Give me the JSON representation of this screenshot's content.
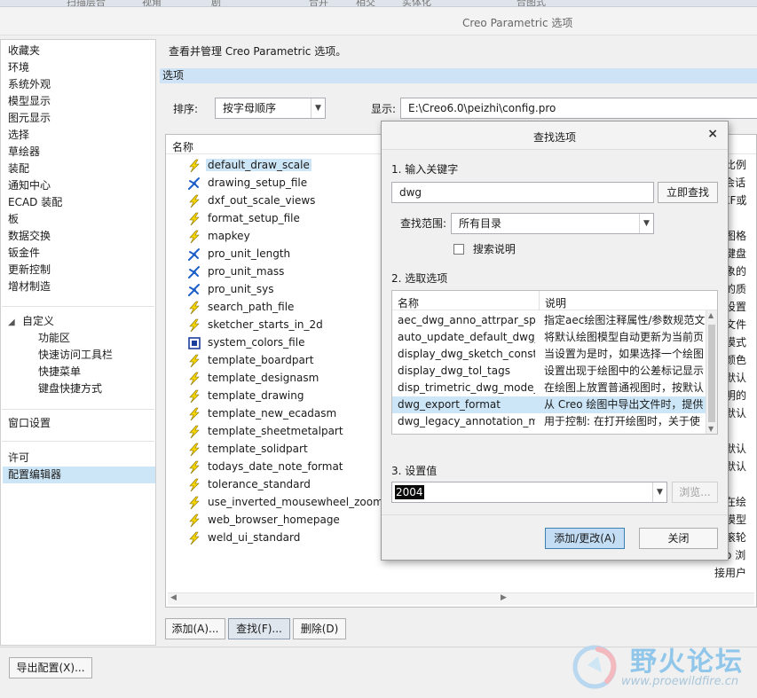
{
  "top_strip": [
    "扫描层合",
    "视角",
    "剧",
    "合并",
    "相交",
    "实体化",
    "合图式"
  ],
  "window_title": "Creo Parametric 选项",
  "sidebar": {
    "items_group1": [
      "收藏夹",
      "环境",
      "系统外观",
      "模型显示",
      "图元显示",
      "选择",
      "草绘器",
      "装配",
      "通知中心",
      "ECAD 装配",
      "板",
      "数据交换",
      "钣金件",
      "更新控制",
      "增材制造"
    ],
    "customize_label": "自定义",
    "customize_items": [
      "功能区",
      "快速访问工具栏",
      "快捷菜单",
      "键盘快捷方式"
    ],
    "window_settings": "窗口设置",
    "license": "许可",
    "config_editor": "配置编辑器"
  },
  "main": {
    "description": "查看并管理 Creo Parametric 选项。",
    "section": "选项",
    "sort_label": "排序:",
    "sort_value": "按字母顺序",
    "show_label": "显示:",
    "show_value": "E:\\Creo6.0\\peizhi\\config.pro",
    "col_name": "名称",
    "options": [
      {
        "icon": "lightning-icon",
        "name": "default_draw_scale",
        "selected": true
      },
      {
        "icon": "blue-star-icon",
        "name": "drawing_setup_file"
      },
      {
        "icon": "lightning-icon",
        "name": "dxf_out_scale_views"
      },
      {
        "icon": "lightning-icon",
        "name": "format_setup_file"
      },
      {
        "icon": "lightning-icon",
        "name": "mapkey"
      },
      {
        "icon": "blue-star-icon",
        "name": "pro_unit_length"
      },
      {
        "icon": "blue-star-icon",
        "name": "pro_unit_mass"
      },
      {
        "icon": "blue-star-icon",
        "name": "pro_unit_sys"
      },
      {
        "icon": "lightning-icon",
        "name": "search_path_file"
      },
      {
        "icon": "lightning-icon",
        "name": "sketcher_starts_in_2d"
      },
      {
        "icon": "box-icon",
        "name": "system_colors_file"
      },
      {
        "icon": "lightning-icon",
        "name": "template_boardpart"
      },
      {
        "icon": "lightning-icon",
        "name": "template_designasm"
      },
      {
        "icon": "lightning-icon",
        "name": "template_drawing"
      },
      {
        "icon": "lightning-icon",
        "name": "template_new_ecadasm"
      },
      {
        "icon": "lightning-icon",
        "name": "template_sheetmetalpart"
      },
      {
        "icon": "lightning-icon",
        "name": "template_solidpart"
      },
      {
        "icon": "lightning-icon",
        "name": "todays_date_note_format"
      },
      {
        "icon": "lightning-icon",
        "name": "tolerance_standard"
      },
      {
        "icon": "lightning-icon",
        "name": "use_inverted_mousewheel_zoom"
      },
      {
        "icon": "lightning-icon",
        "name": "web_browser_homepage"
      },
      {
        "icon": "lightning-icon",
        "name": "weld_ui_standard"
      }
    ],
    "right_fragments": [
      "无比例",
      "o 会话",
      "DXF或",
      "",
      "绘图格",
      "个键盘",
      "对象的",
      "象的质",
      "型设置",
      "本文件",
      "器模式",
      "统颜色",
      "作默认",
      "乐明的",
      "作默认",
      "",
      "作默认",
      "作默认",
      "",
      "示在绘",
      "建模型",
      "示滚轮",
      "reo 浏",
      "接用户"
    ],
    "buttons": {
      "add": "添加(A)...",
      "find": "查找(F)...",
      "delete": "删除(D)"
    },
    "export": "导出配置(X)..."
  },
  "dialog": {
    "title": "查找选项",
    "step1": "1.  输入关键字",
    "keyword": "dwg",
    "find_now": "立即查找",
    "scope_label": "查找范围:",
    "scope_value": "所有目录",
    "search_desc": "搜索说明",
    "step2": "2.  选取选项",
    "col_name": "名称",
    "col_desc": "说明",
    "rows": [
      {
        "name": "aec_dwg_anno_attrpar_spe",
        "desc": "指定aec绘图注释属性/参数规范文"
      },
      {
        "name": "auto_update_default_dwg_m",
        "desc": "将默认绘图模型自动更新为当前页"
      },
      {
        "name": "display_dwg_sketch_constr",
        "desc": "当设置为是时，如果选择一个绘图"
      },
      {
        "name": "display_dwg_tol_tags",
        "desc": "设置出现于绘图中的公差标记显示"
      },
      {
        "name": "disp_trimetric_dwg_mode_v",
        "desc": "在绘图上放置普通视图时，按默认"
      },
      {
        "name": "dwg_export_format",
        "desc": "从 Creo 绘图中导出文件时，提供",
        "selected": true
      },
      {
        "name": "dwg_legacy_annotation_ms",
        "desc": "用于控制: 在打开绘图时，关于使"
      }
    ],
    "step3": "3.  设置值",
    "value": "2004",
    "browse": "浏览...",
    "add_change": "添加/更改(A)",
    "close": "关闭"
  },
  "watermark": {
    "brand": "野火论坛",
    "url": "www.proewildfire.cn"
  }
}
